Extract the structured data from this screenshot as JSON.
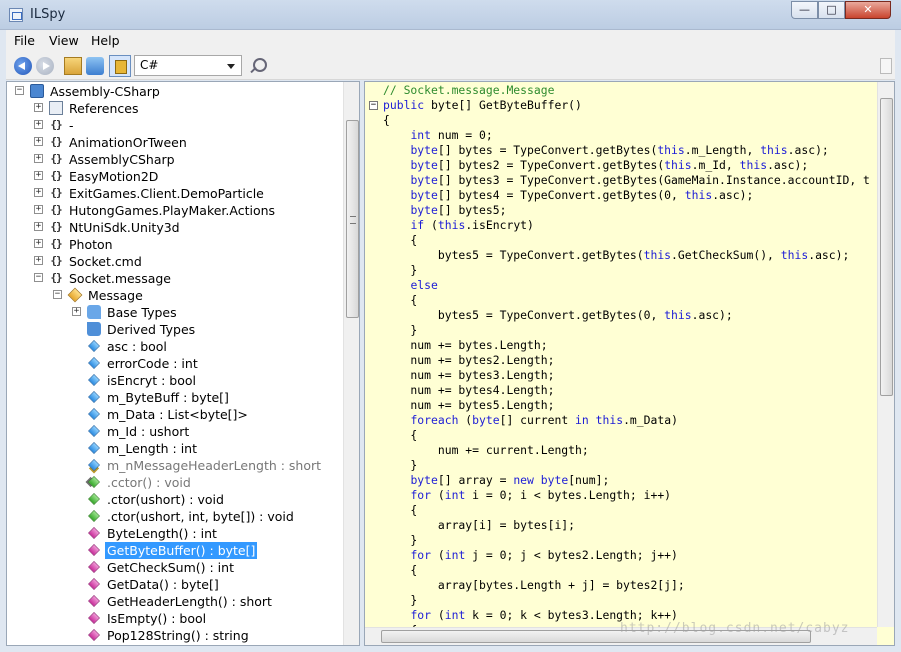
{
  "window": {
    "title": "ILSpy",
    "min_glyph": "—",
    "max_glyph": "□",
    "close_glyph": "✕"
  },
  "menu": [
    "File",
    "View",
    "Help"
  ],
  "toolbar": {
    "language": "C#"
  },
  "tree": [
    {
      "label": "Assembly-CSharp",
      "icon": "assembly-icon",
      "expander": "−"
    },
    {
      "label": "References",
      "icon": "references-icon",
      "expander": "+"
    },
    {
      "label": "-",
      "icon": "namespace-icon",
      "expander": "+"
    },
    {
      "label": "AnimationOrTween",
      "icon": "namespace-icon",
      "expander": "+"
    },
    {
      "label": "AssemblyCSharp",
      "icon": "namespace-icon",
      "expander": "+"
    },
    {
      "label": "EasyMotion2D",
      "icon": "namespace-icon",
      "expander": "+"
    },
    {
      "label": "ExitGames.Client.DemoParticle",
      "icon": "namespace-icon",
      "expander": "+"
    },
    {
      "label": "HutongGames.PlayMaker.Actions",
      "icon": "namespace-icon",
      "expander": "+"
    },
    {
      "label": "NtUniSdk.Unity3d",
      "icon": "namespace-icon",
      "expander": "+"
    },
    {
      "label": "Photon",
      "icon": "namespace-icon",
      "expander": "+"
    },
    {
      "label": "Socket.cmd",
      "icon": "namespace-icon",
      "expander": "+"
    },
    {
      "label": "Socket.message",
      "icon": "namespace-icon",
      "expander": "−"
    },
    {
      "label": "Message",
      "icon": "class-icon",
      "expander": "−"
    },
    {
      "label": "Base Types",
      "icon": "base-types-icon",
      "expander": "+"
    },
    {
      "label": "Derived Types",
      "icon": "derived-types-icon",
      "expander": ""
    },
    {
      "label": "asc : bool",
      "icon": "field-icon"
    },
    {
      "label": "errorCode : int",
      "icon": "field-icon"
    },
    {
      "label": "isEncryt : bool",
      "icon": "field-icon"
    },
    {
      "label": "m_ByteBuff : byte[]",
      "icon": "field-icon"
    },
    {
      "label": "m_Data : List<byte[]>",
      "icon": "field-icon"
    },
    {
      "label": "m_Id : ushort",
      "icon": "field-icon"
    },
    {
      "label": "m_Length : int",
      "icon": "field-icon"
    },
    {
      "label": "m_nMessageHeaderLength : short",
      "icon": "static-field-icon",
      "dim": true
    },
    {
      "label": ".cctor() : void",
      "icon": "static-constructor-icon",
      "dim": true
    },
    {
      "label": ".ctor(ushort) : void",
      "icon": "constructor-icon"
    },
    {
      "label": ".ctor(ushort, int, byte[]) : void",
      "icon": "constructor-icon"
    },
    {
      "label": "ByteLength() : int",
      "icon": "method-icon"
    },
    {
      "label": "GetByteBuffer() : byte[]",
      "icon": "method-icon",
      "selected": true
    },
    {
      "label": "GetCheckSum() : int",
      "icon": "method-icon"
    },
    {
      "label": "GetData() : byte[]",
      "icon": "method-icon"
    },
    {
      "label": "GetHeaderLength() : short",
      "icon": "method-icon"
    },
    {
      "label": "IsEmpty() : bool",
      "icon": "method-icon"
    },
    {
      "label": "Pop128String() : string",
      "icon": "method-icon"
    }
  ],
  "code": [
    [
      [
        "cm",
        "// Socket.message.Message"
      ]
    ],
    [
      [
        "kw",
        "public "
      ],
      [
        "",
        "byte[] GetByteBuffer()"
      ]
    ],
    [
      [
        "",
        "{"
      ]
    ],
    [
      [
        "",
        "    "
      ],
      [
        "kw",
        "int"
      ],
      [
        "",
        " num = 0;"
      ]
    ],
    [
      [
        "",
        "    "
      ],
      [
        "kw",
        "byte"
      ],
      [
        "",
        "[] bytes = TypeConvert.getBytes("
      ],
      [
        "kw",
        "this"
      ],
      [
        "",
        ".m_Length, "
      ],
      [
        "kw",
        "this"
      ],
      [
        "",
        ".asc);"
      ]
    ],
    [
      [
        "",
        "    "
      ],
      [
        "kw",
        "byte"
      ],
      [
        "",
        "[] bytes2 = TypeConvert.getBytes("
      ],
      [
        "kw",
        "this"
      ],
      [
        "",
        ".m_Id, "
      ],
      [
        "kw",
        "this"
      ],
      [
        "",
        ".asc);"
      ]
    ],
    [
      [
        "",
        "    "
      ],
      [
        "kw",
        "byte"
      ],
      [
        "",
        "[] bytes3 = TypeConvert.getBytes(GameMain.Instance.accountID, t"
      ]
    ],
    [
      [
        "",
        "    "
      ],
      [
        "kw",
        "byte"
      ],
      [
        "",
        "[] bytes4 = TypeConvert.getBytes(0, "
      ],
      [
        "kw",
        "this"
      ],
      [
        "",
        ".asc);"
      ]
    ],
    [
      [
        "",
        "    "
      ],
      [
        "kw",
        "byte"
      ],
      [
        "",
        "[] bytes5;"
      ]
    ],
    [
      [
        "",
        "    "
      ],
      [
        "kw",
        "if"
      ],
      [
        "",
        " ("
      ],
      [
        "kw",
        "this"
      ],
      [
        "",
        ".isEncryt)"
      ]
    ],
    [
      [
        "",
        "    {"
      ]
    ],
    [
      [
        "",
        "        bytes5 = TypeConvert.getBytes("
      ],
      [
        "kw",
        "this"
      ],
      [
        "",
        ".GetCheckSum(), "
      ],
      [
        "kw",
        "this"
      ],
      [
        "",
        ".asc);"
      ]
    ],
    [
      [
        "",
        "    }"
      ]
    ],
    [
      [
        "",
        "    "
      ],
      [
        "kw",
        "else"
      ]
    ],
    [
      [
        "",
        "    {"
      ]
    ],
    [
      [
        "",
        "        bytes5 = TypeConvert.getBytes(0, "
      ],
      [
        "kw",
        "this"
      ],
      [
        "",
        ".asc);"
      ]
    ],
    [
      [
        "",
        "    }"
      ]
    ],
    [
      [
        "",
        "    num += bytes.Length;"
      ]
    ],
    [
      [
        "",
        "    num += bytes2.Length;"
      ]
    ],
    [
      [
        "",
        "    num += bytes3.Length;"
      ]
    ],
    [
      [
        "",
        "    num += bytes4.Length;"
      ]
    ],
    [
      [
        "",
        "    num += bytes5.Length;"
      ]
    ],
    [
      [
        "",
        "    "
      ],
      [
        "kw",
        "foreach"
      ],
      [
        "",
        " ("
      ],
      [
        "kw",
        "byte"
      ],
      [
        "",
        "[] current "
      ],
      [
        "kw",
        "in"
      ],
      [
        "",
        " "
      ],
      [
        "kw",
        "this"
      ],
      [
        "",
        ".m_Data)"
      ]
    ],
    [
      [
        "",
        "    {"
      ]
    ],
    [
      [
        "",
        "        num += current.Length;"
      ]
    ],
    [
      [
        "",
        "    }"
      ]
    ],
    [
      [
        "",
        "    "
      ],
      [
        "kw",
        "byte"
      ],
      [
        "",
        "[] array = "
      ],
      [
        "kw",
        "new"
      ],
      [
        "",
        " "
      ],
      [
        "kw",
        "byte"
      ],
      [
        "",
        "[num];"
      ]
    ],
    [
      [
        "",
        "    "
      ],
      [
        "kw",
        "for"
      ],
      [
        "",
        " ("
      ],
      [
        "kw",
        "int"
      ],
      [
        "",
        " i = 0; i < bytes.Length; i++)"
      ]
    ],
    [
      [
        "",
        "    {"
      ]
    ],
    [
      [
        "",
        "        array[i] = bytes[i];"
      ]
    ],
    [
      [
        "",
        "    }"
      ]
    ],
    [
      [
        "",
        "    "
      ],
      [
        "kw",
        "for"
      ],
      [
        "",
        " ("
      ],
      [
        "kw",
        "int"
      ],
      [
        "",
        " j = 0; j < bytes2.Length; j++)"
      ]
    ],
    [
      [
        "",
        "    {"
      ]
    ],
    [
      [
        "",
        "        array[bytes.Length + j] = bytes2[j];"
      ]
    ],
    [
      [
        "",
        "    }"
      ]
    ],
    [
      [
        "",
        "    "
      ],
      [
        "kw",
        "for"
      ],
      [
        "",
        " ("
      ],
      [
        "kw",
        "int"
      ],
      [
        "",
        " k = 0; k < bytes3.Length; k++)"
      ]
    ],
    [
      [
        "",
        "    {"
      ]
    ]
  ],
  "watermark": "http://blog.csdn.net/cabyz"
}
